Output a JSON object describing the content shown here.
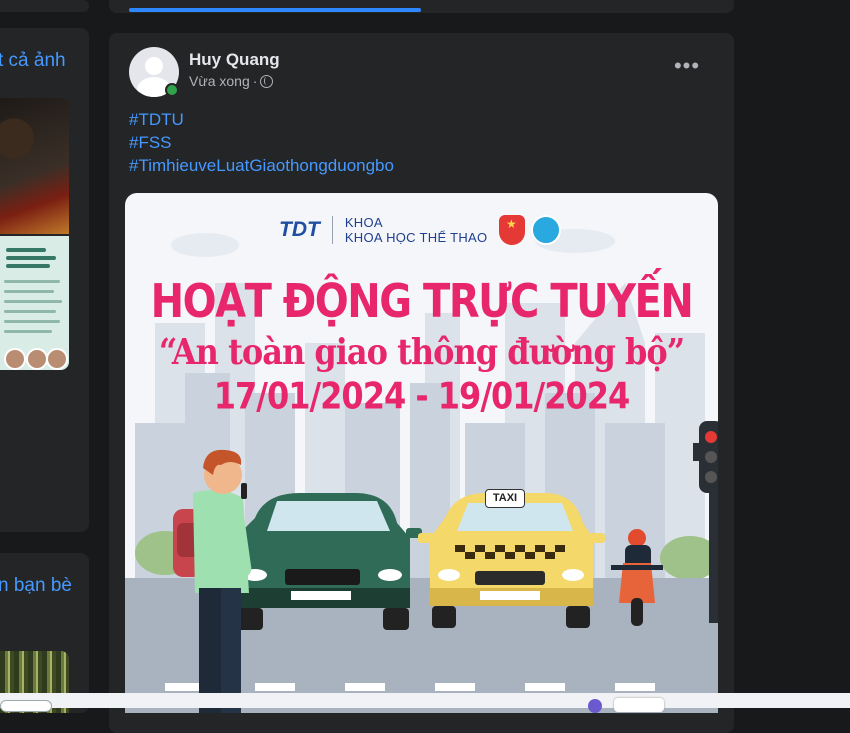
{
  "left_column": {
    "photos_link": "t cả ảnh",
    "friends_link": "n bạn bè"
  },
  "post": {
    "author": "Huy Quang",
    "time": "Vừa xong",
    "separator": "·",
    "privacy_icon": "globe-icon",
    "more_icon": "more-options-icon",
    "more_label": "•••",
    "hashtags": [
      "#TDTU",
      "#FSS",
      "#TimhieuveLuatGiaothongduongbo"
    ],
    "image": {
      "logo_text": "TDT",
      "dept_line1": "KHOA",
      "dept_line2": "KHOA HỌC THỂ THAO",
      "title": "HOẠT ĐỘNG TRỰC TUYẾN",
      "subtitle": "“An toàn giao thông đường bộ”",
      "dates": "17/01/2024 - 19/01/2024",
      "taxi_sign": "TAXI"
    }
  },
  "colors": {
    "background": "#18191a",
    "card": "#242526",
    "link": "#4599ff",
    "accent": "#2d88ff",
    "poster_pink": "#e8266b",
    "online": "#31a24c"
  }
}
